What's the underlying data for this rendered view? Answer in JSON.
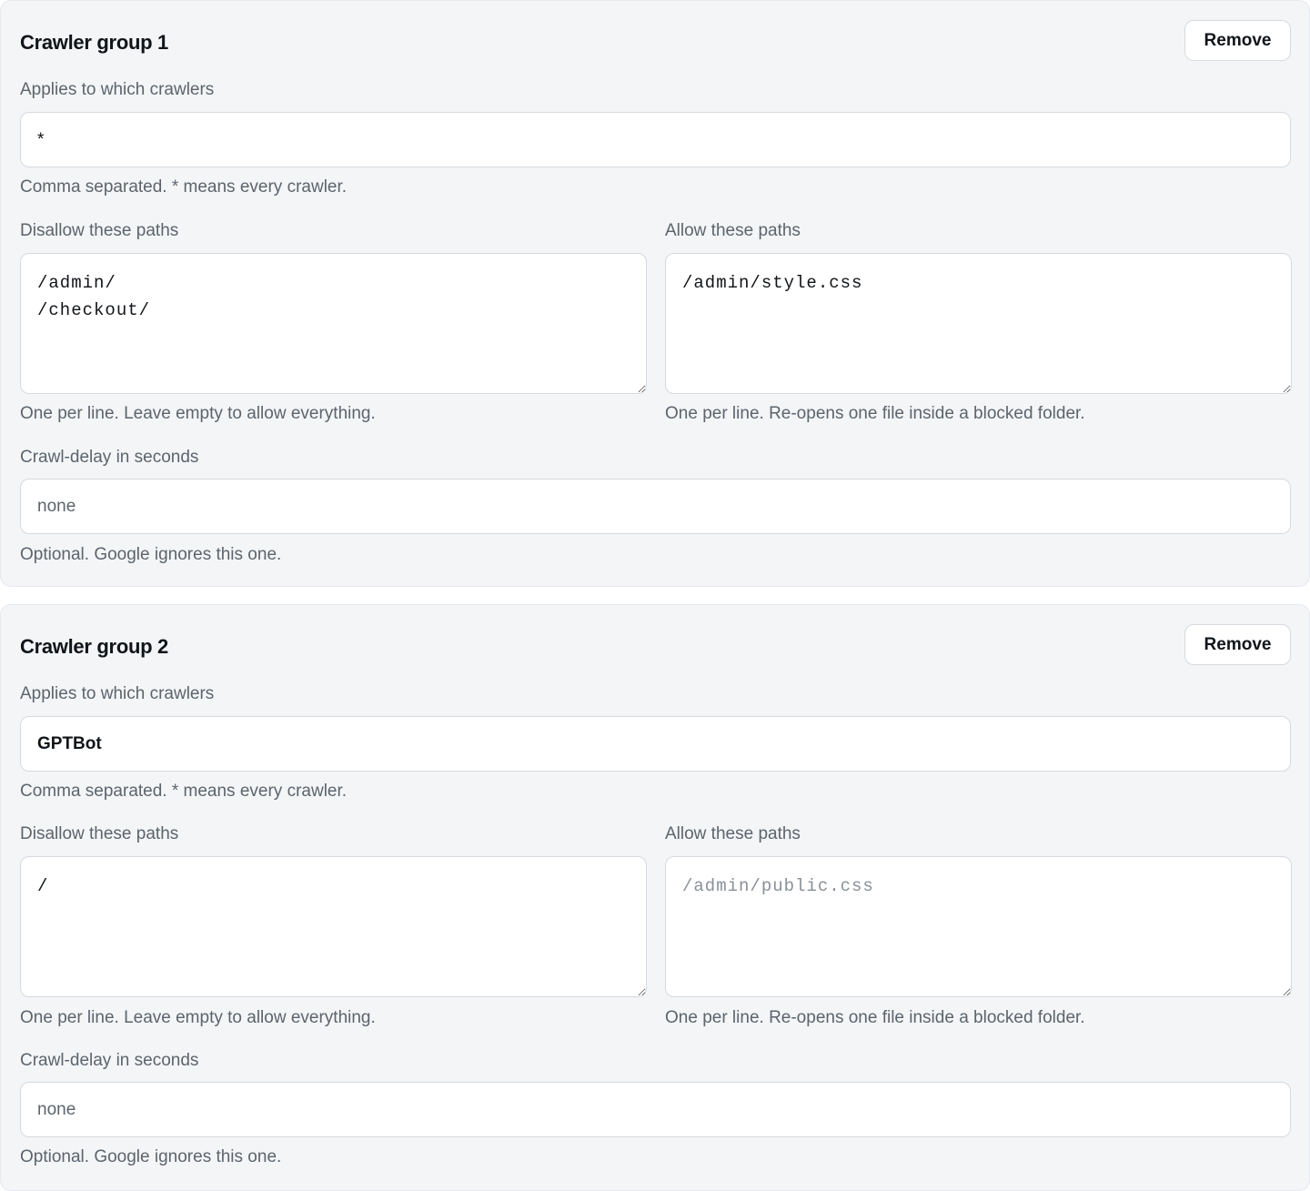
{
  "groups": [
    {
      "title": "Crawler group 1",
      "remove_label": "Remove",
      "crawlers_label": "Applies to which crawlers",
      "crawlers_value": "*",
      "crawlers_hint": "Comma separated. * means every crawler.",
      "disallow_label": "Disallow these paths",
      "disallow_value": "/admin/\n/checkout/",
      "disallow_placeholder": "",
      "disallow_hint": "One per line. Leave empty to allow everything.",
      "allow_label": "Allow these paths",
      "allow_value": "/admin/style.css",
      "allow_placeholder": "",
      "allow_hint": "One per line. Re-opens one file inside a blocked folder.",
      "delay_label": "Crawl-delay in seconds",
      "delay_value": "",
      "delay_placeholder": "none",
      "delay_hint": "Optional. Google ignores this one."
    },
    {
      "title": "Crawler group 2",
      "remove_label": "Remove",
      "crawlers_label": "Applies to which crawlers",
      "crawlers_value": "GPTBot",
      "crawlers_hint": "Comma separated. * means every crawler.",
      "disallow_label": "Disallow these paths",
      "disallow_value": "/",
      "disallow_placeholder": "",
      "disallow_hint": "One per line. Leave empty to allow everything.",
      "allow_label": "Allow these paths",
      "allow_value": "",
      "allow_placeholder": "/admin/public.css",
      "allow_hint": "One per line. Re-opens one file inside a blocked folder.",
      "delay_label": "Crawl-delay in seconds",
      "delay_value": "",
      "delay_placeholder": "none",
      "delay_hint": "Optional. Google ignores this one."
    }
  ]
}
